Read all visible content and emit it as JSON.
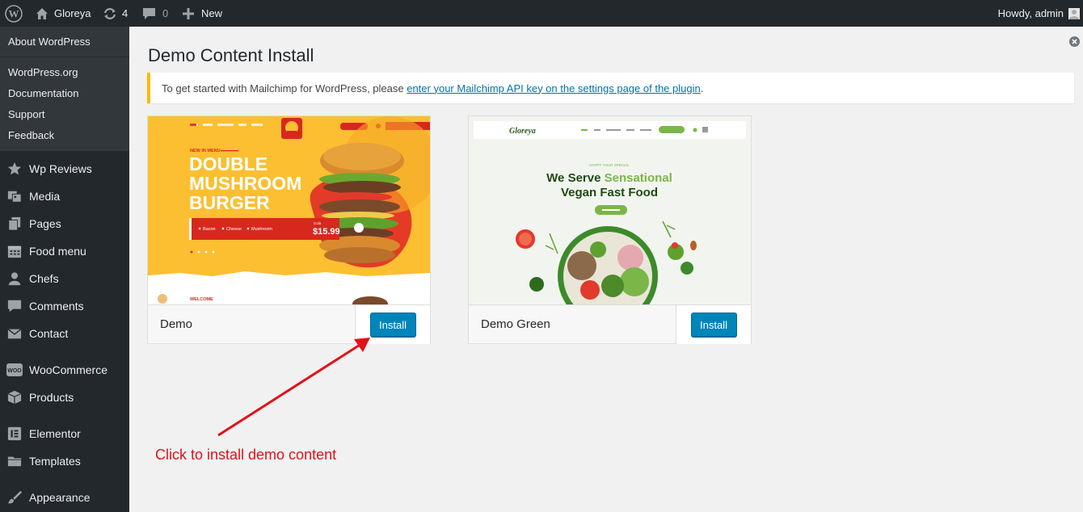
{
  "adminbar": {
    "site_name": "Gloreya",
    "updates_count": "4",
    "comments_count": "0",
    "new_label": "New",
    "howdy": "Howdy, admin"
  },
  "submenu": {
    "about": "About WordPress",
    "links": [
      "WordPress.org",
      "Documentation",
      "Support",
      "Feedback"
    ]
  },
  "menu": {
    "items": [
      {
        "label": "Wp Reviews",
        "icon": "star-icon"
      },
      {
        "label": "Media",
        "icon": "media-icon"
      },
      {
        "label": "Pages",
        "icon": "pages-icon"
      },
      {
        "label": "Food menu",
        "icon": "calendar-icon"
      },
      {
        "label": "Chefs",
        "icon": "user-icon"
      },
      {
        "label": "Comments",
        "icon": "comment-icon"
      },
      {
        "label": "Contact",
        "icon": "mail-icon"
      },
      {
        "label": "WooCommerce",
        "icon": "woocommerce-icon"
      },
      {
        "label": "Products",
        "icon": "box-icon"
      },
      {
        "label": "Elementor",
        "icon": "elementor-icon"
      },
      {
        "label": "Templates",
        "icon": "folder-icon"
      },
      {
        "label": "Appearance",
        "icon": "brush-icon"
      }
    ]
  },
  "page": {
    "title": "Demo Content Install",
    "notice_text": "To get started with Mailchimp for WordPress, please ",
    "notice_link": "enter your Mailchimp API key on the settings page of the plugin",
    "notice_end": "."
  },
  "themes": [
    {
      "name": "Demo",
      "button": "Install",
      "preview": {
        "new_in_menu": "NEW IN MENU",
        "headline": [
          "DOUBLE",
          "MUSHROOM",
          "BURGER"
        ],
        "options": [
          "Bacon",
          "Cheese",
          "Mushroom"
        ],
        "price_label": "Cola",
        "price": "$15.99",
        "welcome": "WELCOME",
        "logo": "Gloreya"
      }
    },
    {
      "name": "Demo Green",
      "button": "Install",
      "preview": {
        "kicker": "HAPPY YOUR SPECIAL",
        "headline_1a": "We Serve ",
        "headline_1b": "Sensational",
        "headline_2": "Vegan Fast Food",
        "logo": "Gloreya"
      }
    }
  ],
  "annotation": "Click to install demo content",
  "colors": {
    "adminbar_bg": "#23282d",
    "submenu_bg": "#32373c",
    "button_blue": "#0085ba",
    "link_blue": "#0073aa",
    "notice_border": "#ffb900",
    "annotation_red": "#e0121a"
  }
}
